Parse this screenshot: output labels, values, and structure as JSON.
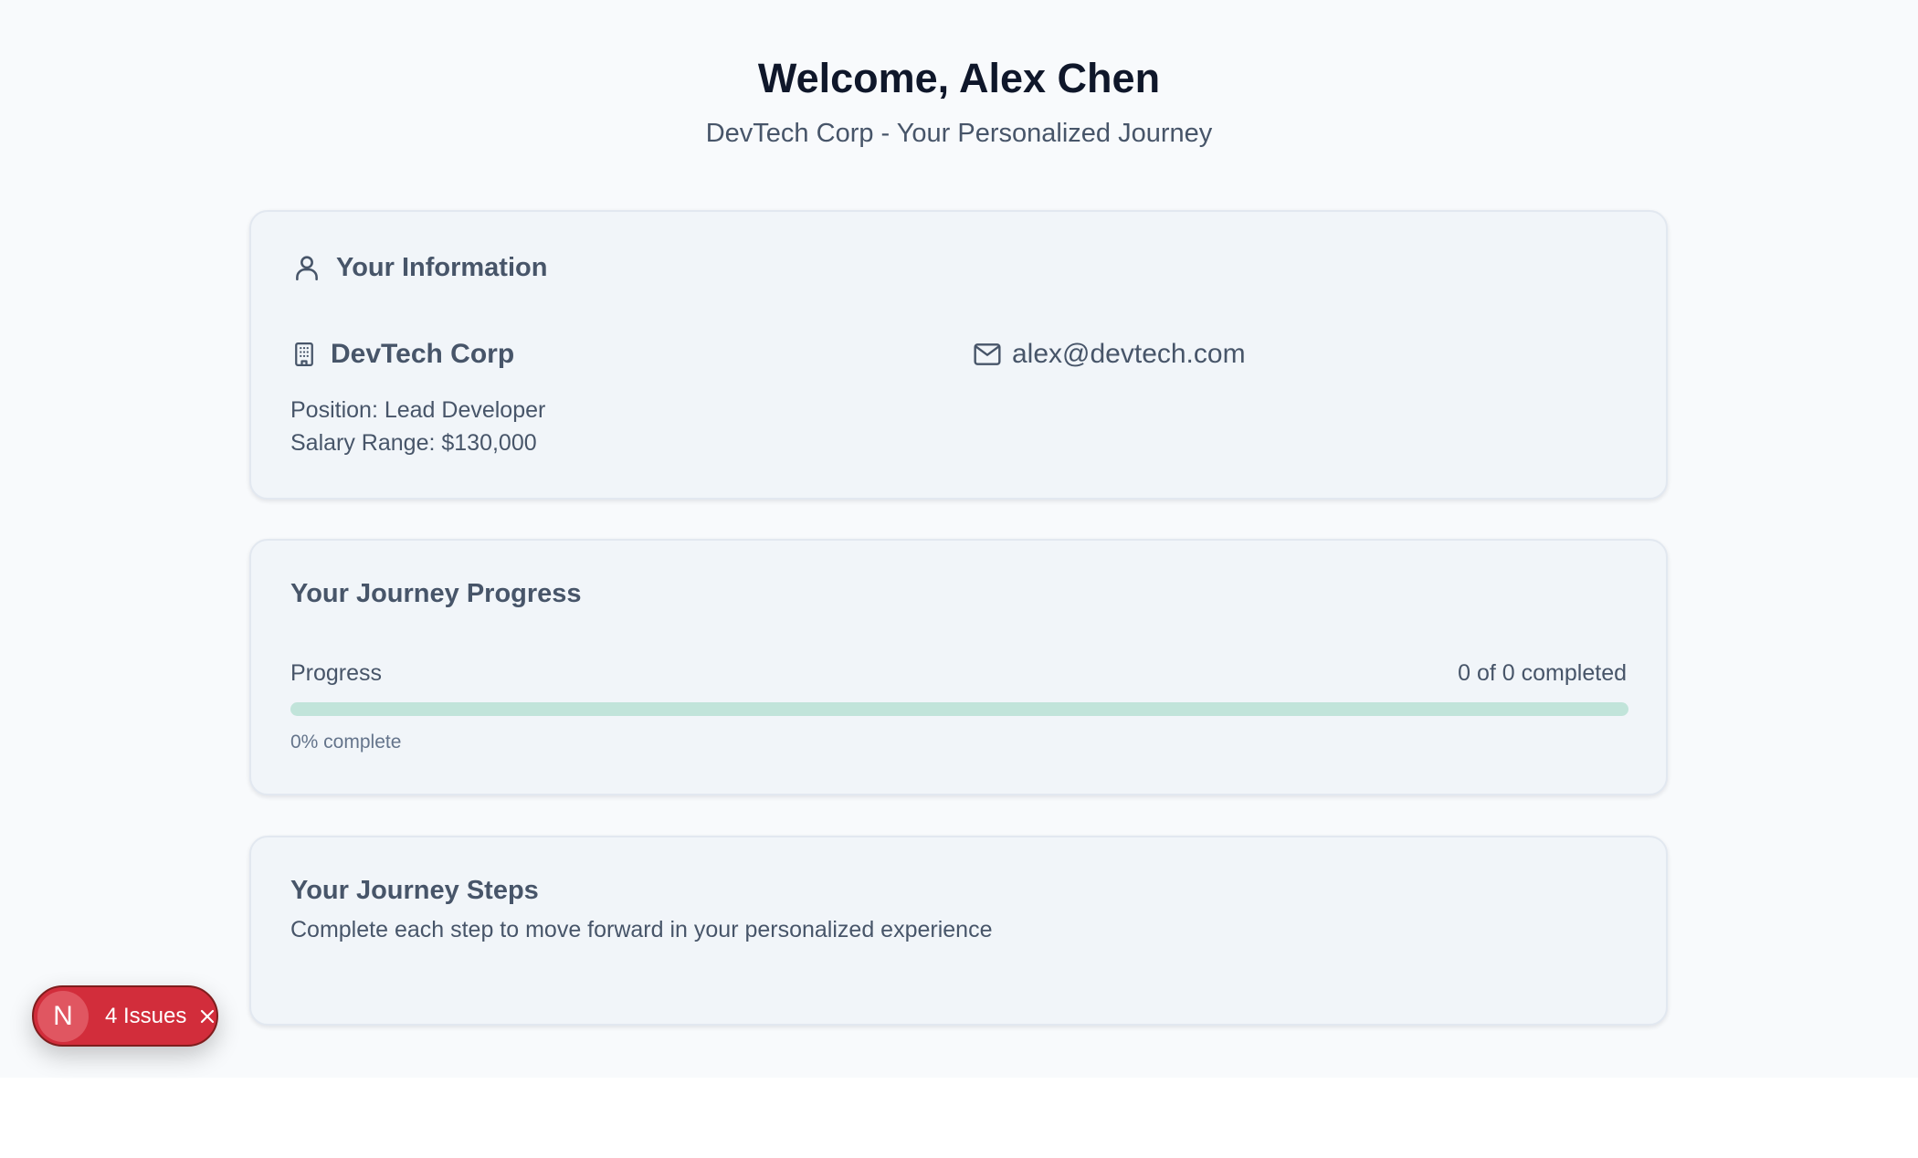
{
  "header": {
    "title": "Welcome, Alex Chen",
    "subtitle": "DevTech Corp - Your Personalized Journey"
  },
  "info_card": {
    "title": "Your Information",
    "company": "DevTech Corp",
    "email": "alex@devtech.com",
    "position": "Position: Lead Developer",
    "salary": "Salary Range: $130,000",
    "icons": [
      "user-icon",
      "building-icon",
      "mail-icon"
    ]
  },
  "progress_card": {
    "title": "Your Journey Progress",
    "label": "Progress",
    "count": "0 of 0 completed",
    "percent_text": "0% complete",
    "progress_fraction": 0,
    "track_color": "#c1e4da",
    "fill_color": "#10b981"
  },
  "steps_card": {
    "title": "Your Journey Steps",
    "description": "Complete each step to move forward in your personalized experience"
  },
  "issues_badge": {
    "logo": "N",
    "label": "4 Issues",
    "color": "#d22d3b",
    "icons": [
      "close-icon"
    ]
  }
}
